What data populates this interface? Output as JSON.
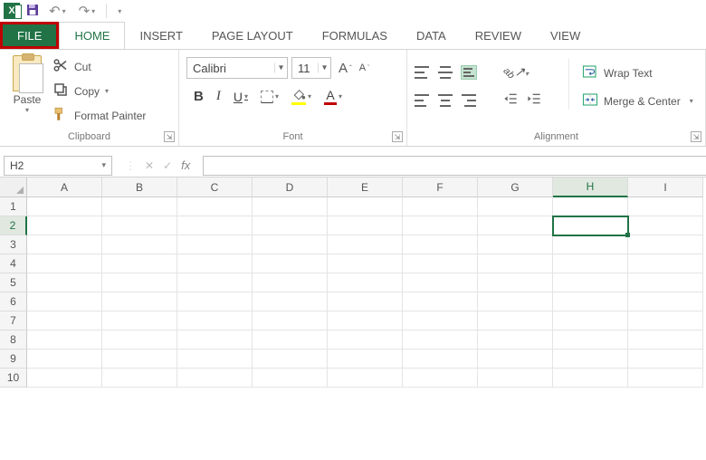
{
  "qat": {
    "undo": "↶",
    "redo": "↷"
  },
  "tabs": {
    "file": "FILE",
    "home": "HOME",
    "insert": "INSERT",
    "page_layout": "PAGE LAYOUT",
    "formulas": "FORMULAS",
    "data": "DATA",
    "review": "REVIEW",
    "view": "VIEW"
  },
  "clipboard": {
    "paste": "Paste",
    "cut": "Cut",
    "copy": "Copy",
    "format_painter": "Format Painter",
    "group_title": "Clipboard"
  },
  "font": {
    "name": "Calibri",
    "size": "11",
    "bold": "B",
    "italic": "I",
    "underline": "U",
    "increase": "A",
    "decrease": "A",
    "color_letter": "A",
    "group_title": "Font"
  },
  "alignment": {
    "wrap_text": "Wrap Text",
    "merge_center": "Merge & Center",
    "group_title": "Alignment"
  },
  "namebox": {
    "value": "H2"
  },
  "fx_label": "fx",
  "fx_cancel": "✕",
  "fx_enter": "✓",
  "columns": [
    "A",
    "B",
    "C",
    "D",
    "E",
    "F",
    "G",
    "H",
    "I"
  ],
  "rows": [
    "1",
    "2",
    "3",
    "4",
    "5",
    "6",
    "7",
    "8",
    "9",
    "10"
  ],
  "selected_column": "H",
  "selected_row": "2",
  "orient_glyph": "ab"
}
